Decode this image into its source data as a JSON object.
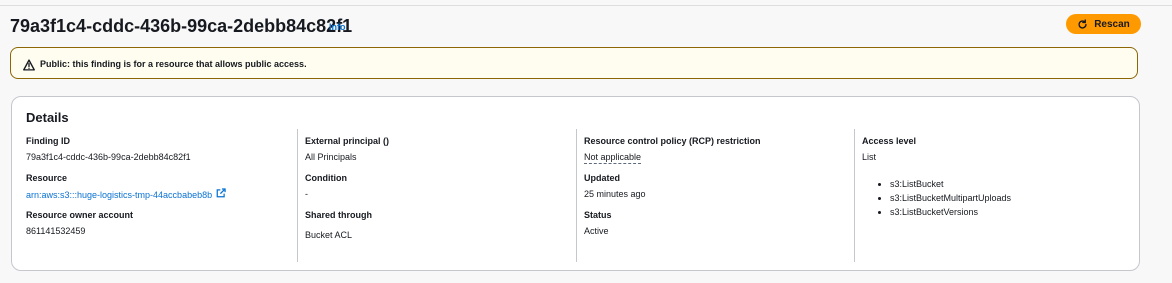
{
  "header": {
    "title": "79a3f1c4-cddc-436b-99ca-2debb84c82f1",
    "info_label": "Info",
    "rescan_label": "Rescan"
  },
  "alert": {
    "text": "Public: this finding is for a resource that allows public access."
  },
  "details": {
    "title": "Details",
    "finding_id": {
      "label": "Finding ID",
      "value": "79a3f1c4-cddc-436b-99ca-2debb84c82f1"
    },
    "resource": {
      "label": "Resource",
      "value": "arn:aws:s3:::huge-logistics-tmp-44accbabeb8b"
    },
    "owner_account": {
      "label": "Resource owner account",
      "value": "861141532459"
    },
    "external_principal": {
      "label": "External principal ()",
      "value": "All Principals"
    },
    "condition": {
      "label": "Condition",
      "value": "-"
    },
    "shared_through": {
      "label": "Shared through",
      "value": "Bucket ACL"
    },
    "rcp": {
      "label": "Resource control policy (RCP) restriction",
      "value": "Not applicable"
    },
    "updated": {
      "label": "Updated",
      "value": "25 minutes ago"
    },
    "status": {
      "label": "Status",
      "value": "Active"
    },
    "access_level": {
      "label": "Access level",
      "value": "List",
      "actions": [
        "s3:ListBucket",
        "s3:ListBucketMultipartUploads",
        "s3:ListBucketVersions"
      ]
    }
  },
  "colors": {
    "accent": "#ff9900",
    "link": "#0972d3",
    "warning_border": "#8d6605",
    "warning_bg": "#fffdf0"
  },
  "icons": {
    "rescan": "refresh-icon",
    "alert": "warning-icon",
    "resource_link": "external-link-icon"
  }
}
